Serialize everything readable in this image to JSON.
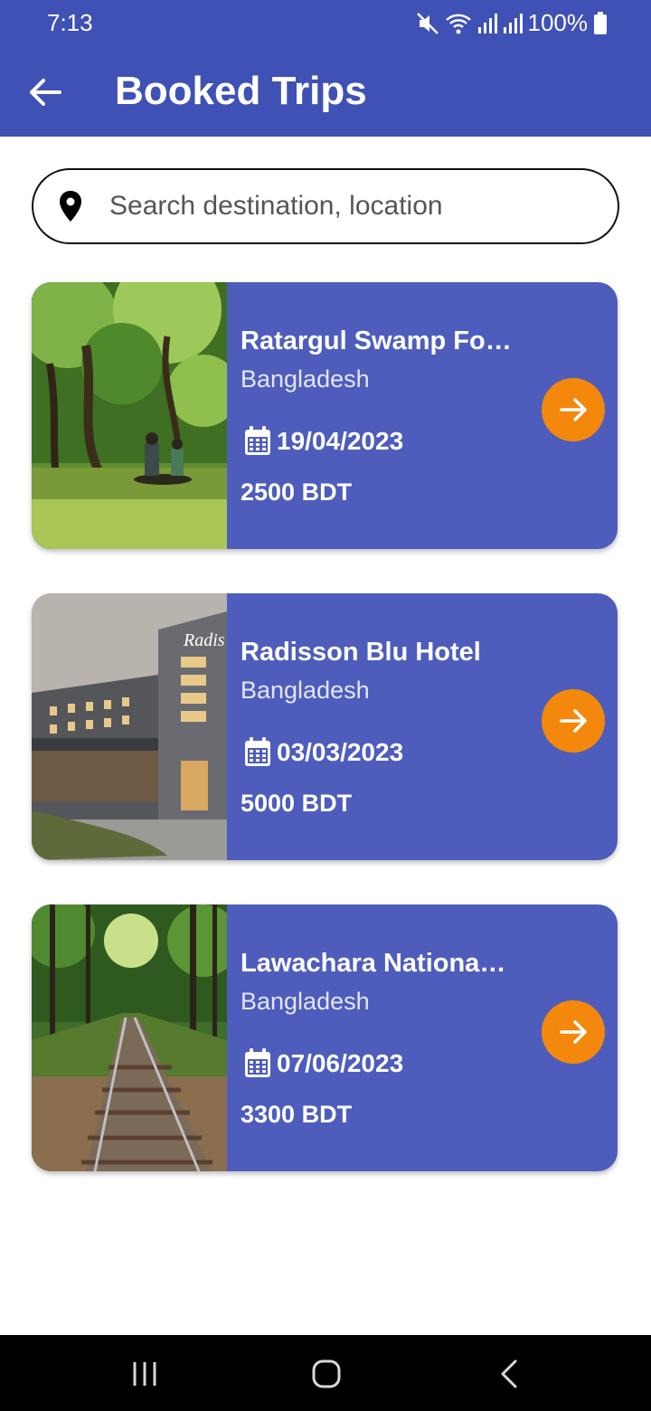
{
  "status_bar": {
    "time": "7:13",
    "battery": "100%"
  },
  "header": {
    "title": "Booked Trips"
  },
  "search": {
    "placeholder": "Search destination, location"
  },
  "trips": [
    {
      "name": "Ratargul Swamp Forest",
      "country": "Bangladesh",
      "date": "19/04/2023",
      "price": "2500 BDT"
    },
    {
      "name": "Radisson Blu Hotel",
      "country": "Bangladesh",
      "date": "03/03/2023",
      "price": "5000 BDT"
    },
    {
      "name": "Lawachara National Park",
      "country": "Bangladesh",
      "date": "07/06/2023",
      "price": "3300 BDT"
    }
  ],
  "colors": {
    "app_bar": "#3f51b5",
    "card": "#4e5dbc",
    "accent": "#f4880c"
  },
  "icons": [
    "back-arrow-icon",
    "location-pin-icon",
    "calendar-icon",
    "arrow-right-icon",
    "mute-icon",
    "wifi-icon",
    "signal-icon",
    "battery-icon"
  ]
}
